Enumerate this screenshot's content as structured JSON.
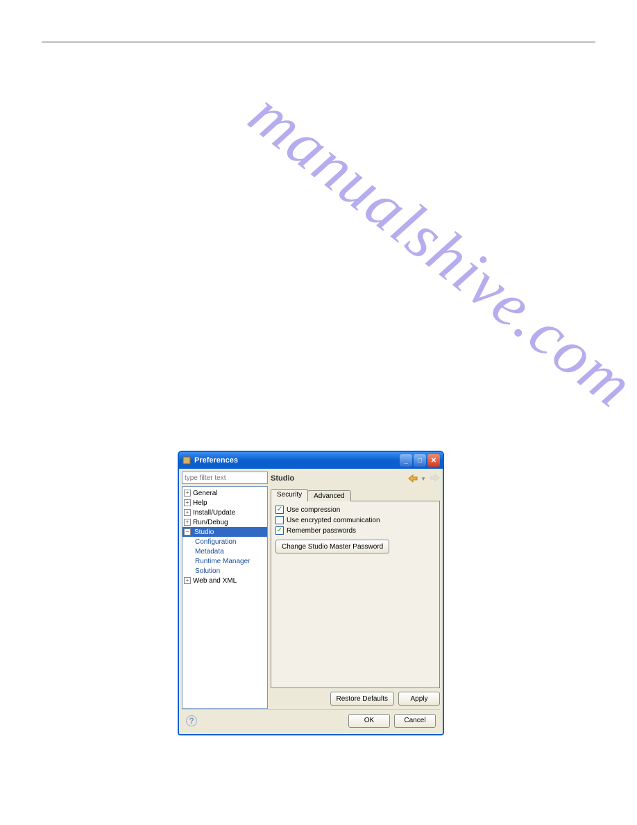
{
  "watermark": "manualshive.com",
  "dialog": {
    "title": "Preferences",
    "filterPlaceholder": "type filter text",
    "tree": {
      "general": "General",
      "help": "Help",
      "installUpdate": "Install/Update",
      "runDebug": "Run/Debug",
      "studio": "Studio",
      "children": {
        "configuration": "Configuration",
        "metadata": "Metadata",
        "runtimeManager": "Runtime Manager",
        "solution": "Solution"
      },
      "webXml": "Web and XML"
    },
    "rightTitle": "Studio",
    "tabs": {
      "security": "Security",
      "advanced": "Advanced"
    },
    "options": {
      "useCompression": "Use compression",
      "useEncrypted": "Use encrypted communication",
      "rememberPasswords": "Remember passwords"
    },
    "changePasswordBtn": "Change Studio Master Password",
    "restoreDefaults": "Restore Defaults",
    "apply": "Apply",
    "ok": "OK",
    "cancel": "Cancel"
  }
}
